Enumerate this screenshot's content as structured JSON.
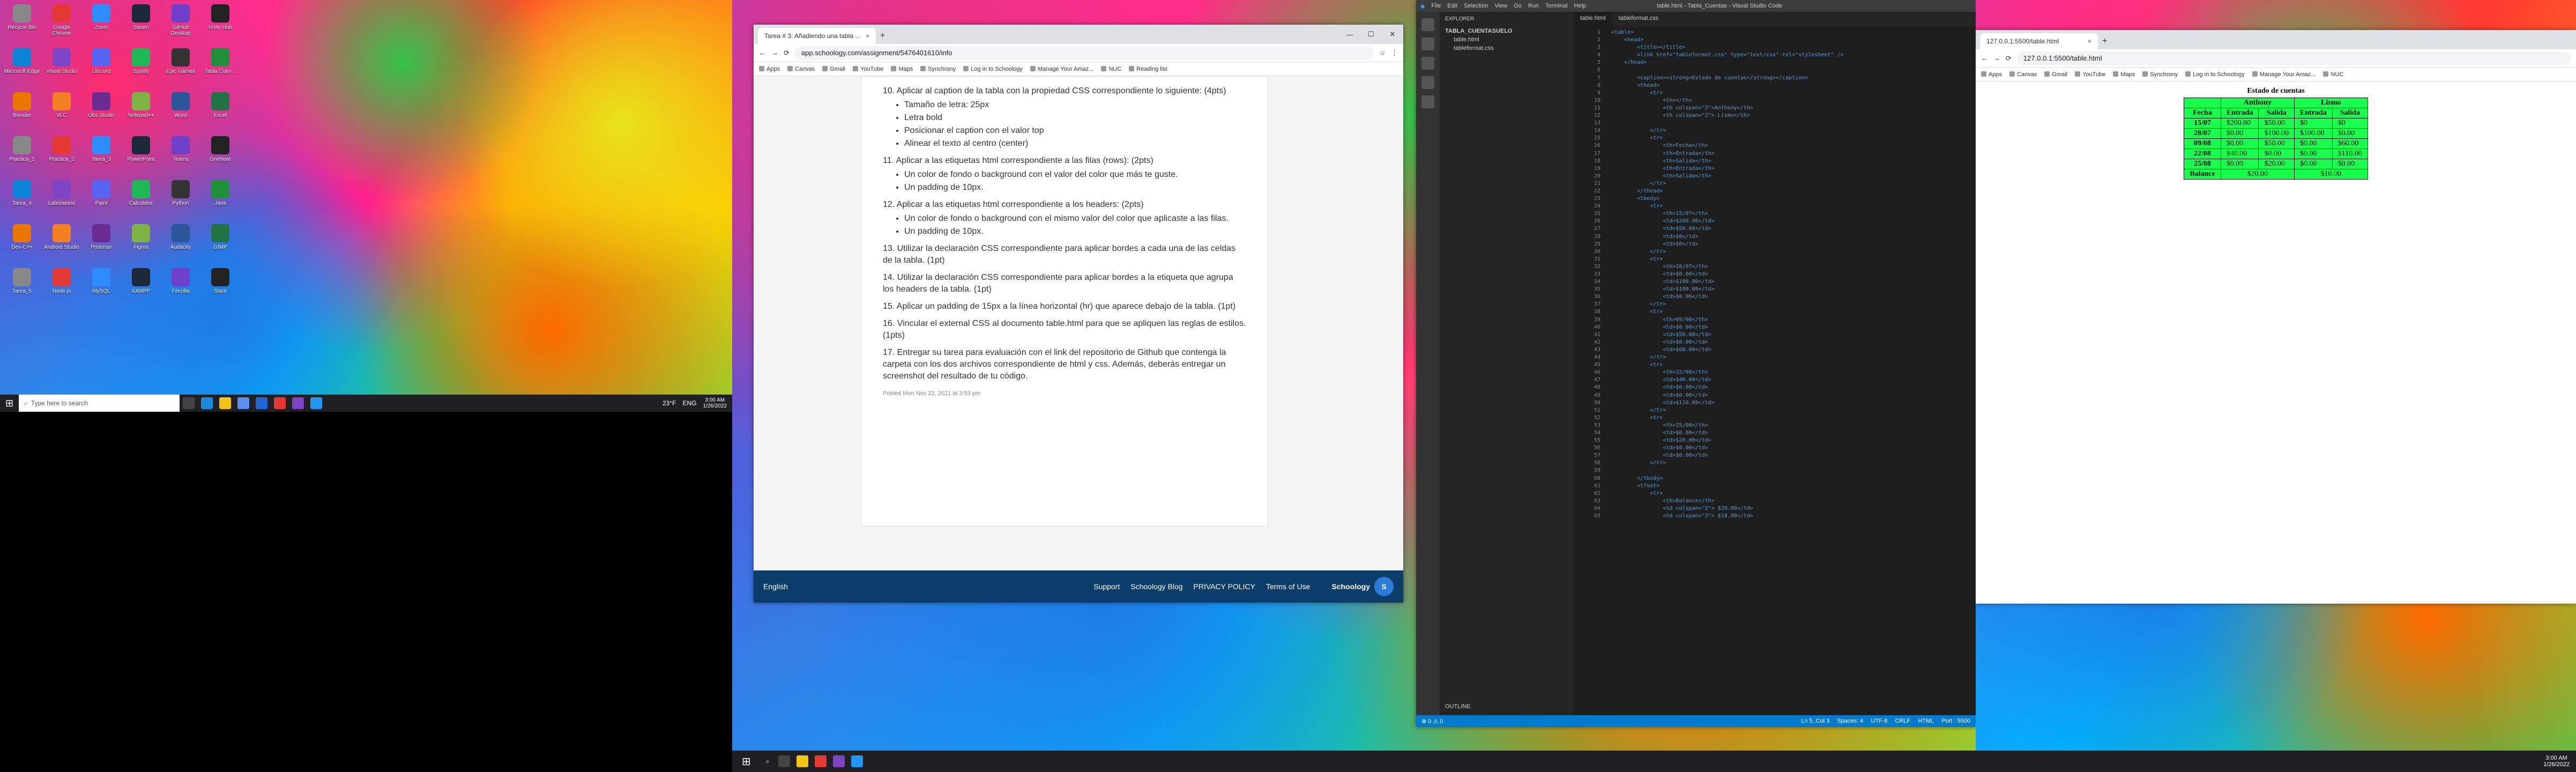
{
  "monitor1": {
    "desktop_icons": [
      "Recycle Bin",
      "Google Chrome",
      "Zoom",
      "Steam",
      "GitHub Desktop",
      "Unity Hub",
      "Microsoft Edge",
      "Visual Studio",
      "Discord",
      "Spotify",
      "Epic Games",
      "Tabla Cuen...",
      "Blender",
      "VLC",
      "Obs Studio",
      "Notepad++",
      "Word",
      "Excel",
      "Practica_1",
      "Practica_2",
      "Tarea_3",
      "PowerPoint",
      "Teams",
      "OneNote",
      "Tarea_4",
      "Laboratorio",
      "Paint",
      "Calculator",
      "Python",
      "Java",
      "Dev-C++",
      "Android Studio",
      "Postman",
      "Figma",
      "Audacity",
      "GIMP",
      "Tarea_5",
      "Node.js",
      "MySQL",
      "XAMPP",
      "Filezilla",
      "Slack"
    ],
    "search_placeholder": "Type here to search",
    "weather": "23°F",
    "lang": "ENG",
    "time": "3:00 AM",
    "date": "1/26/2022"
  },
  "chrome": {
    "tab_title": "Tarea # 3: Añadiendo una tabla ...",
    "url": "app.schoology.com/assignment/5476401610/info",
    "bookmarks": [
      "Apps",
      "Canvas",
      "Gmail",
      "YouTube",
      "Maps",
      "Synchrony",
      "Log in to Schoology",
      "Manage Your Amaz...",
      "NUC",
      "Reading list"
    ],
    "items": [
      {
        "text": "10. Aplicar al caption de la tabla con la propiedad CSS correspondiente lo siguiente: (4pts)",
        "sub": [
          "Tamaño de letra: 25px",
          "Letra bold",
          "Posicionar el caption con el valor top",
          "Alinear el texto al centro (center)"
        ]
      },
      {
        "text": "11. Aplicar a las etiquetas html correspondiente a las filas (rows): (2pts)",
        "sub": [
          "Un color de fondo o background con el valor del color que más te guste.",
          "Un padding de 10px."
        ]
      },
      {
        "text": "12. Aplicar a las etiquetas html correspondiente a los headers: (2pts)",
        "sub": [
          "Un color de fondo o background con el mismo valor del color que aplicaste a las filas.",
          "Un padding de 10px."
        ]
      },
      {
        "text": "13. Utilizar la declaración CSS correspondiente para aplicar bordes a cada una de las celdas de la tabla. (1pt)",
        "sub": []
      },
      {
        "text": "14. Utilizar la declaración CSS correspondiente para aplicar bordes a la etiqueta que agrupa los headers de la tabla. (1pt)",
        "sub": []
      },
      {
        "text": "15. Aplicar un padding de 15px a la línea horizontal (hr) que aparece debajo de la tabla. (1pt)",
        "sub": []
      },
      {
        "text": "16. Vincular el external CSS al documento table.html para que se apliquen las reglas de estilos. (1pts)",
        "sub": []
      },
      {
        "text": "17. Entregar su tarea para evaluación con el link del repositorio de Github que contenga la carpeta con los dos archivos correspondiente de html y css. Además, deberás entregar un screenshot del resultado de tu código.",
        "sub": []
      }
    ],
    "posted": "Posted Mon Nov 22, 2021 at 3:53 pm",
    "footer": {
      "lang": "English",
      "links": [
        "Support",
        "Schoology Blog",
        "PRIVACY POLICY",
        "Terms of Use"
      ],
      "brand": "Schoology"
    }
  },
  "vscode": {
    "title": "table.html - Tabla_Cuentas - Visual Studio Code",
    "menu": [
      "File",
      "Edit",
      "Selection",
      "View",
      "Go",
      "Run",
      "Terminal",
      "Help"
    ],
    "explorer_label": "EXPLORER",
    "folder": "TABLA_CUENTASUELO",
    "files": [
      "table.html",
      "tableformat.css"
    ],
    "outline": "OUTLINE",
    "tabs": [
      "table.html",
      "tableformat.css"
    ],
    "status": {
      "left": "⊗ 0 ⚠ 0",
      "pos": "Ln 5, Col 3",
      "spaces": "Spaces: 4",
      "enc": "UTF-8",
      "eol": "CRLF",
      "lang": "HTML",
      "port": "Port : 5500"
    },
    "code": [
      "<table>",
      "    <head>",
      "        <title></title>",
      "        <link href=\"tableformat.css\" type=\"text/css\" rel=\"stylesheet\" />",
      "    </head>",
      "",
      "        <caption><strong>Estado de cuentas</strong></caption>",
      "        <thead>",
      "            <tr>",
      "                <th></th>",
      "                <th colspan=\"2\">Anthony</th>",
      "                <th colspan=\"2\"> Lismo</th>",
      "",
      "            </tr>",
      "            <tr>",
      "                <th>Fecha</th>",
      "                <th>Entrada</th>",
      "                <th>Salida</th>",
      "                <th>Entrada</th>",
      "                <th>Salida</th>",
      "            </tr>",
      "        </thead>",
      "        <tbody>",
      "            <tr>",
      "                <th>15/07</th>",
      "                <td>$200.00</td>",
      "                <td>$50.00</td>",
      "                <td>$0</td>",
      "                <td>$0</td>",
      "            </tr>",
      "            <tr>",
      "                <th>28/07</th>",
      "                <td>$0.00</td>",
      "                <td>$100.00</td>",
      "                <td>$100.00</td>",
      "                <td>$0.00</td>",
      "            </tr>",
      "            <tr>",
      "                <th>09/08</th>",
      "                <td>$0.00</td>",
      "                <td>$50.00</td>",
      "                <td>$0.00</td>",
      "                <td>$60.00</td>",
      "            </tr>",
      "            <tr>",
      "                <th>22/08</th>",
      "                <td>$40.00</td>",
      "                <td>$0.00</td>",
      "                <td>$0.00</td>",
      "                <td>$110.00</td>",
      "            </tr>",
      "            <tr>",
      "                <th>25/08</th>",
      "                <td>$0.00</td>",
      "                <td>$20.00</td>",
      "                <td>$0.00</td>",
      "                <td>$0.00</td>",
      "            </tr>",
      "",
      "        </tbody>",
      "        <tfoot>",
      "            <tr>",
      "                <th>Balance</th>",
      "                <td colspan=\"2\"> $20.00</td>",
      "                <td colspan=\"2\"> $10.00</td>"
    ]
  },
  "preview": {
    "tab_title": "127.0.0.1:5500/table.html",
    "url": "127.0.0.1:5500/table.html",
    "bookmarks": [
      "Apps",
      "Canvas",
      "Gmail",
      "YouTube",
      "Maps",
      "Synchrony",
      "Log in to Schoology",
      "Manage Your Amaz...",
      "NUC"
    ],
    "caption": "Estado de cuentas",
    "groups": [
      "Anthony",
      "Lismo"
    ],
    "headers": [
      "Fecha",
      "Entrada",
      "Salida",
      "Entrada",
      "Salida"
    ],
    "rows": [
      [
        "15/07",
        "$200.00",
        "$50.00",
        "$0",
        "$0"
      ],
      [
        "28/07",
        "$0.00",
        "$100.00",
        "$100.00",
        "$0.00"
      ],
      [
        "09/08",
        "$0.00",
        "$50.00",
        "$0.00",
        "$60.00"
      ],
      [
        "22/08",
        "$40.00",
        "$0.00",
        "$0.00",
        "$110.00"
      ],
      [
        "25/08",
        "$0.00",
        "$20.00",
        "$0.00",
        "$0.00"
      ]
    ],
    "balance": [
      "Balance",
      "$20.00",
      "$10.00"
    ]
  },
  "monitor3": {
    "time": "3:00 AM",
    "date": "1/26/2022"
  }
}
